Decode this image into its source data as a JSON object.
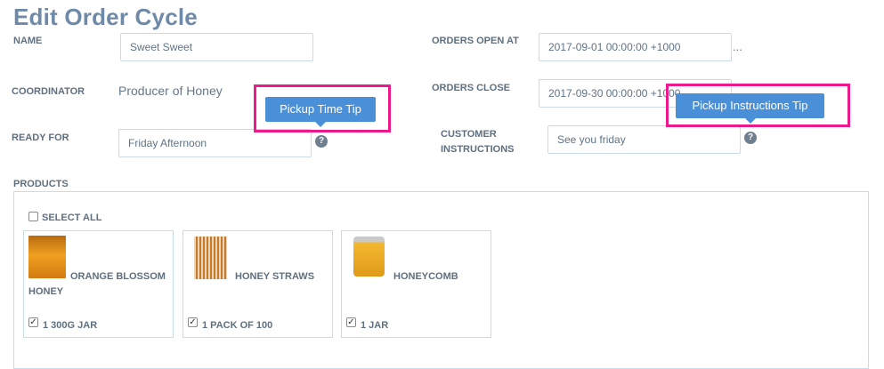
{
  "page": {
    "title": "Edit Order Cycle"
  },
  "form": {
    "name": {
      "label": "NAME",
      "value": "Sweet Sweet"
    },
    "orders_open_at": {
      "label": "ORDERS OPEN AT",
      "value": "2017-09-01 00:00:00 +1000",
      "suffix": "..."
    },
    "coordinator": {
      "label": "COORDINATOR",
      "value": "Producer of Honey"
    },
    "orders_close": {
      "label": "ORDERS CLOSE",
      "value": "2017-09-30 00:00:00 +1000"
    },
    "ready_for": {
      "label": "READY FOR",
      "value": "Friday Afternoon"
    },
    "customer_instructions": {
      "label_line1": "CUSTOMER",
      "label_line2": "INSTRUCTIONS",
      "value": "See you friday"
    }
  },
  "tooltips": {
    "pickup_time": "Pickup Time Tip",
    "pickup_instructions": "Pickup Instructions Tip"
  },
  "help_glyph": "?",
  "products": {
    "label": "PRODUCTS",
    "select_all": "SELECT ALL",
    "items": [
      {
        "name_line1": "ORANGE BLOSSOM",
        "name_line2": "HONEY",
        "variant": "1 300G JAR",
        "checked": true
      },
      {
        "name_line1": "HONEY STRAWS",
        "name_line2": "",
        "variant": "1 PACK OF 100",
        "checked": true
      },
      {
        "name_line1": "HONEYCOMB",
        "name_line2": "",
        "variant": "1 JAR",
        "checked": true
      }
    ]
  },
  "colors": {
    "accent": "#4a90d9",
    "highlight": "#ec1a8c",
    "border": "#c9dbe7",
    "title": "#6f8aa8"
  }
}
